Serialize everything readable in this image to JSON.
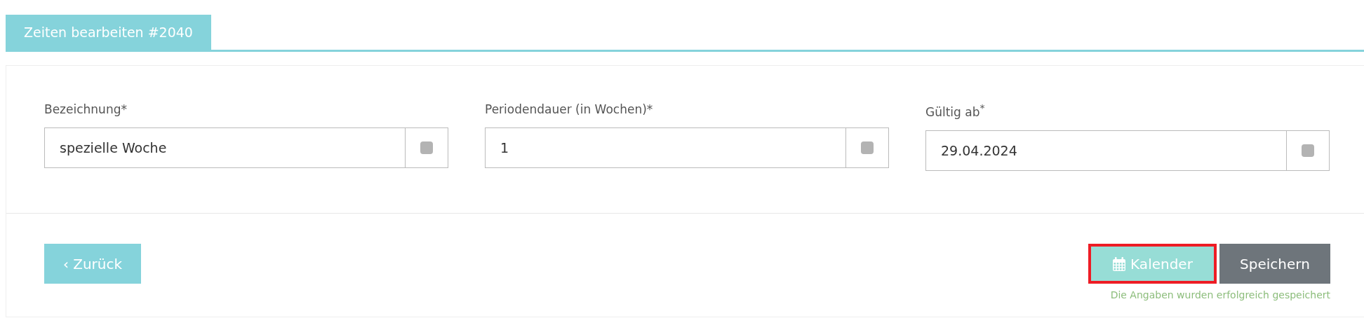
{
  "tab": {
    "label": "Zeiten bearbeiten #2040",
    "selected": true
  },
  "fields": [
    {
      "label": "Bezeichnung*",
      "value": "spezielle Woche",
      "checked": false
    },
    {
      "label": "Periodendauer (in Wochen)*",
      "value": "1",
      "checked": false
    },
    {
      "label": "Gültig ab$^{*}$",
      "value": "29.04.2024",
      "checked": false
    }
  ],
  "back_button": {
    "label": "Zurück",
    "icon": "‹"
  },
  "buttons": [
    {
      "label": "Kalender",
      "kind": "calendar",
      "highlighted": true
    },
    {
      "label": "Speichern",
      "kind": "save",
      "highlighted": false
    }
  ],
  "status_message": "Die Angaben wurden erfolgreich gespeichert"
}
